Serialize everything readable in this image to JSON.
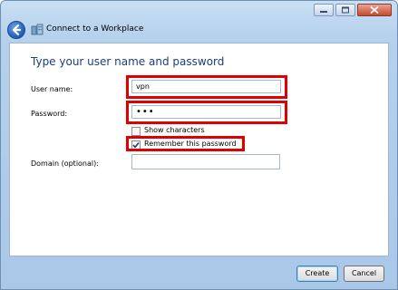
{
  "window": {
    "title": "Connect to a Workplace",
    "icons": {
      "back": "back-arrow-icon",
      "app": "network-workplace-icon"
    }
  },
  "form": {
    "heading": "Type your user name and password",
    "username": {
      "label": "User name:",
      "value": "vpn"
    },
    "password": {
      "label": "Password:",
      "value": "•••"
    },
    "show_characters": {
      "label": "Show characters",
      "checked": false
    },
    "remember_password": {
      "label": "Remember this password",
      "checked": true
    },
    "domain": {
      "label": "Domain (optional):",
      "value": ""
    }
  },
  "buttons": {
    "create": "Create",
    "cancel": "Cancel"
  },
  "colors": {
    "highlight": "#e10000",
    "heading": "#1a3e7c"
  }
}
